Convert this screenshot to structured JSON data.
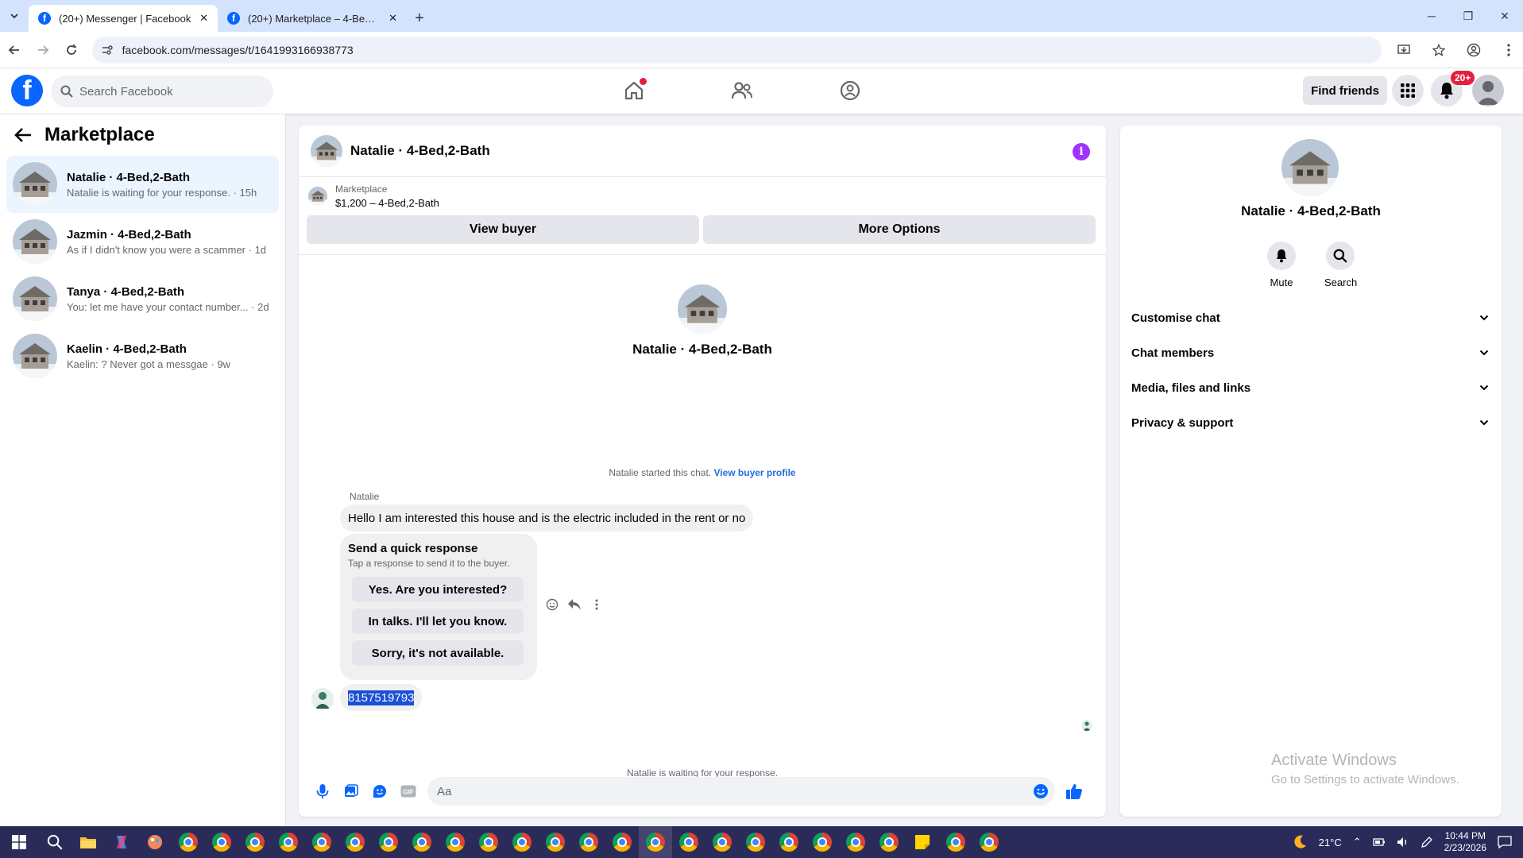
{
  "browser": {
    "tabs": [
      {
        "title": "(20+) Messenger | Facebook",
        "active": true
      },
      {
        "title": "(20+) Marketplace – 4-Bed,2-Bath",
        "active": false
      }
    ],
    "url": "facebook.com/messages/t/1641993166938773"
  },
  "facebook": {
    "search_placeholder": "Search Facebook",
    "find_friends": "Find friends",
    "notifications_badge": "20+",
    "brand_color": "#0866ff"
  },
  "sidebar": {
    "title": "Marketplace",
    "conversations": [
      {
        "name": "Natalie · 4-Bed,2-Bath",
        "preview": "Natalie is waiting for your response. · 15h",
        "active": true
      },
      {
        "name": "Jazmin · 4-Bed,2-Bath",
        "preview": "As if I didn't know you were a scammer · 1d",
        "active": false
      },
      {
        "name": "Tanya · 4-Bed,2-Bath",
        "preview": "You: let me have your contact number... · 2d",
        "active": false
      },
      {
        "name": "Kaelin · 4-Bed,2-Bath",
        "preview": "Kaelin: ? Never got a messgae · 9w",
        "active": false
      }
    ]
  },
  "chat": {
    "title": "Natalie · 4-Bed,2-Bath",
    "listing_source": "Marketplace",
    "listing_title": "$1,200 – 4-Bed,2-Bath",
    "view_buyer": "View buyer",
    "more_options": "More Options",
    "profile_name": "Natalie · 4-Bed,2-Bath",
    "started_text": "Natalie started this chat.",
    "view_profile_link": "View buyer profile",
    "sender_name": "Natalie",
    "message_1": "Hello I am interested this house and is the electric included in the rent or no",
    "quick_title": "Send a quick response",
    "quick_sub": "Tap a response to send it to the buyer.",
    "quick_responses": [
      "Yes. Are you interested?",
      "In talks. I'll let you know.",
      "Sorry, it's not available."
    ],
    "my_message": "8157519793",
    "waiting_text": "Natalie is waiting for your response.",
    "composer_placeholder": "Aa",
    "accent_color": "#0866ff"
  },
  "details": {
    "name": "Natalie · 4-Bed,2-Bath",
    "mute": "Mute",
    "search": "Search",
    "sections": [
      "Customise chat",
      "Chat members",
      "Media, files and links",
      "Privacy & support"
    ]
  },
  "watermark": {
    "line1": "Activate Windows",
    "line2": "Go to Settings to activate Windows."
  },
  "taskbar": {
    "weather": "21°C",
    "time": "10:44 PM",
    "date": "2/23/2026"
  }
}
